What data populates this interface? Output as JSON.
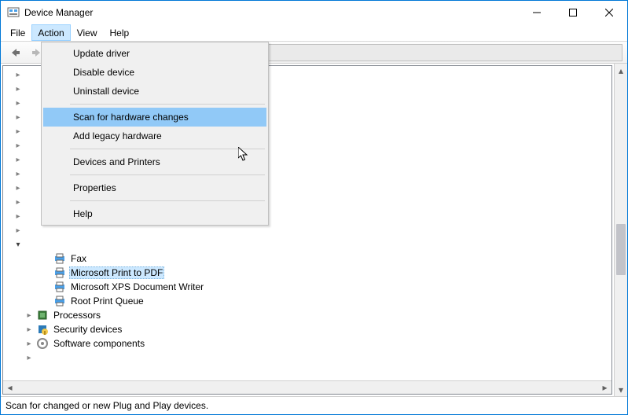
{
  "title": "Device Manager",
  "menubar": {
    "file": "File",
    "action": "Action",
    "view": "View",
    "help": "Help"
  },
  "dropdown": {
    "update": "Update driver",
    "disable": "Disable device",
    "uninstall": "Uninstall device",
    "scan": "Scan for hardware changes",
    "addlegacy": "Add legacy hardware",
    "devprint": "Devices and Printers",
    "properties": "Properties",
    "help": "Help"
  },
  "tree": {
    "children": [
      {
        "label": "Fax"
      },
      {
        "label": "Microsoft Print to PDF",
        "selected": true
      },
      {
        "label": "Microsoft XPS Document Writer"
      },
      {
        "label": "Root Print Queue"
      }
    ],
    "cat_processors": "Processors",
    "cat_security": "Security devices",
    "cat_software": "Software components"
  },
  "statusbar": "Scan for changed or new Plug and Play devices."
}
